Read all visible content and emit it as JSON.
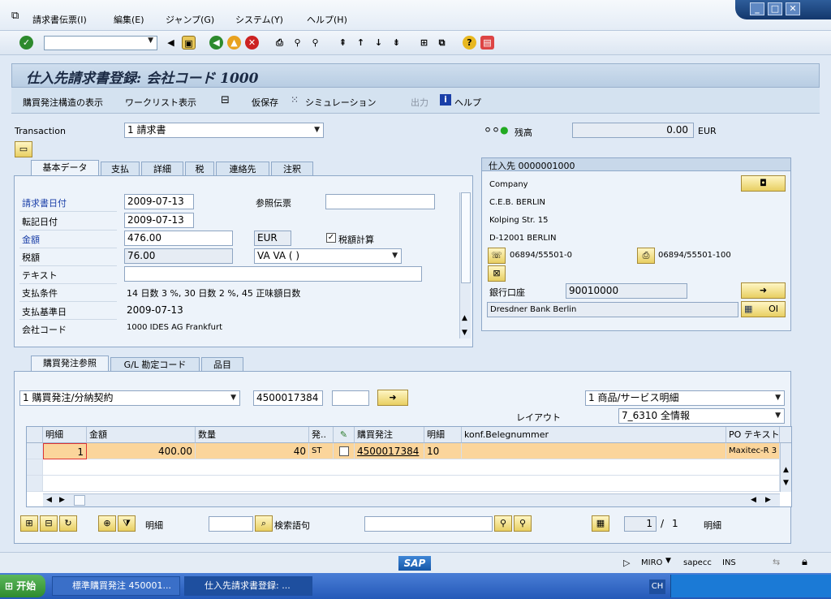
{
  "menu": {
    "items": [
      "請求書伝票(I)",
      "編集(E)",
      "ジャンプ(G)",
      "システム(Y)",
      "ヘルプ(H)"
    ]
  },
  "title": "仕入先請求書登録: 会社コード 1000",
  "app_toolbar": {
    "po_structure": "購買発注構造の表示",
    "worklist": "ワークリスト表示",
    "park": "仮保存",
    "simulation": "シミュレーション",
    "output": "出力",
    "help": "ヘルプ"
  },
  "transaction": {
    "label": "Transaction",
    "value": "1 請求書"
  },
  "balance": {
    "label": "残高",
    "value": "0.00",
    "currency": "EUR"
  },
  "tabs_top": [
    "基本データ",
    "支払",
    "詳細",
    "税",
    "連絡先",
    "注釈"
  ],
  "basic": {
    "invoice_date_label": "請求書日付",
    "invoice_date": "2009-07-13",
    "reference_label": "参照伝票",
    "reference": "",
    "posting_date_label": "転記日付",
    "posting_date": "2009-07-13",
    "amount_label": "金額",
    "amount": "476.00",
    "currency": "EUR",
    "calc_tax_label": "税額計算",
    "tax_label": "税額",
    "tax": "76.00",
    "tax_code": "VA VA ( )",
    "text_label": "テキスト",
    "text": "",
    "payment_terms_label": "支払条件",
    "payment_terms": "14 日数 3 %, 30 日数 2 %, 45 正味額日数",
    "baseline_date_label": "支払基準日",
    "baseline_date": "2009-07-13",
    "company_label": "会社コード",
    "company": "1000 IDES AG Frankfurt"
  },
  "vendor": {
    "header": "仕入先 0000001000",
    "title": "Company",
    "name": "C.E.B. BERLIN",
    "street": "Kolping Str. 15",
    "city": "D-12001 BERLIN",
    "phone": "06894/55501-0",
    "fax": "06894/55501-100",
    "bank_label": "銀行口座",
    "bank_account": "90010000",
    "bank_name": "Dresdner Bank Berlin",
    "oi_label": "OI"
  },
  "tabs_bottom": [
    "購買発注参照",
    "G/L 勘定コード",
    "品目"
  ],
  "po_ref": {
    "type": "1 購買発注/分納契約",
    "po_number": "4500017384",
    "item": "",
    "layout_type": "1 商品/サービス明細",
    "layout_label": "レイアウト",
    "layout": "7_6310 全情報"
  },
  "grid": {
    "headers": [
      "明細",
      "金額",
      "数量",
      "発..",
      "",
      "購買発注",
      "明細",
      "konf.Belegnummer",
      "PO テキスト"
    ],
    "row": {
      "item": "1",
      "amount": "400.00",
      "qty": "40",
      "unit": "ST",
      "po": "4500017384",
      "po_item": "10",
      "confirm": "",
      "po_text": "Maxitec-R 3"
    }
  },
  "footer": {
    "item_label": "明細",
    "search_label": "検索語句",
    "page_current": "1",
    "page_sep": "/",
    "page_total": "1",
    "page_label": "明細"
  },
  "status": {
    "system": "MIRO",
    "client": "sapecc",
    "mode": "INS",
    "logo": "SAP"
  },
  "taskbar": {
    "start": "开始",
    "tasks": [
      "標準購買発注 450001...",
      "仕入先請求書登録: ..."
    ],
    "lang": "CH"
  }
}
